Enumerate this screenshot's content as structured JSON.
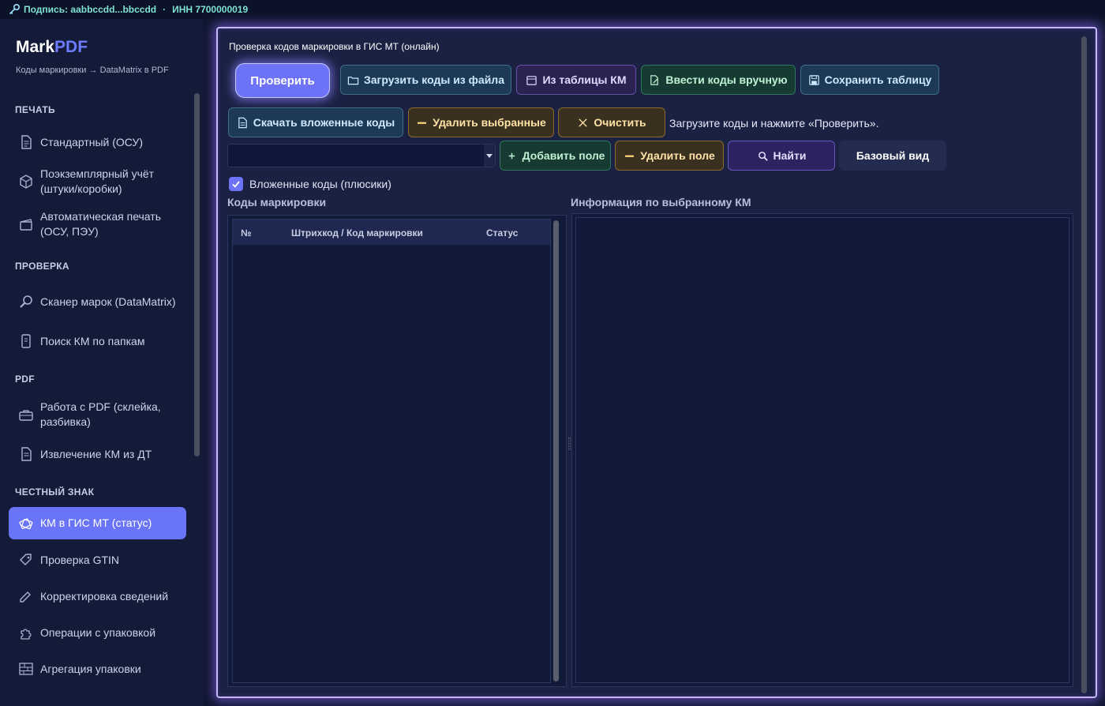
{
  "topbar": {
    "signature": "Подпись: aabbccdd...bbccdd",
    "separator": "·",
    "inn": "ИНН 7700000019",
    "icon": "key-icon"
  },
  "sidebar": {
    "brand_main": "Mark",
    "brand_accent": "PDF",
    "subtitle": "Коды маркировки → DataMatrix в PDF",
    "sections": {
      "print": "ПЕЧАТЬ",
      "check": "ПРОВЕРКА",
      "pdf": "PDF",
      "honest": "ЧЕСТНЫЙ ЗНАК"
    },
    "items": [
      {
        "label": "Стандартный (ОСУ)",
        "icon": "document-icon"
      },
      {
        "label": "Поэкземплярный учёт (штуки/коробки)",
        "icon": "box-icon"
      },
      {
        "label": "Автоматическая печать (ОСУ, ПЭУ)",
        "icon": "clapper-icon"
      },
      {
        "label": "Сканер марок (DataMatrix)",
        "icon": "magnifier-icon"
      },
      {
        "label": "Поиск КМ по папкам",
        "icon": "file-search-icon"
      },
      {
        "label": "Работа с PDF (склейка, разбивка)",
        "icon": "toolbox-icon"
      },
      {
        "label": "Извлечение КМ из ДТ",
        "icon": "document-icon"
      },
      {
        "label": "КМ в ГИС МТ (статус)",
        "icon": "tickets-icon"
      },
      {
        "label": "Проверка GTIN",
        "icon": "tag-icon"
      },
      {
        "label": "Корректировка сведений",
        "icon": "pencil-icon"
      },
      {
        "label": "Операции с упаковкой",
        "icon": "puzzle-icon"
      },
      {
        "label": "Агрегация упаковки",
        "icon": "bricks-icon"
      }
    ],
    "active_index": 7
  },
  "main": {
    "title": "Проверка кодов маркировки в ГИС МТ (онлайн)",
    "buttons": {
      "check": "Проверить",
      "load_file": "Загрузить коды из файла",
      "from_table": "Из таблицы КМ",
      "manual": "Ввести коды вручную",
      "save_table": "Сохранить таблицу",
      "download_nested": "Скачать вложенные коды",
      "delete_selected": "Удалить выбранные",
      "clear": "Очистить",
      "add_field": "Добавить поле",
      "delete_field": "Удалить поле",
      "find": "Найти",
      "base_view": "Базовый вид"
    },
    "hint": "Загрузите коды и нажмите «Проверить».",
    "combo_value": "",
    "nested_checkbox": {
      "label": "Вложенные коды (плюсики)",
      "checked": true
    },
    "codes_title": "Коды маркировки",
    "info_title": "Информация по выбранному КМ",
    "table": {
      "columns": [
        "№",
        "Штрихкод / Код маркировки",
        "Статус"
      ],
      "rows": []
    }
  },
  "colors": {
    "accent": "#6d73f7",
    "glow": "#c8b7ff",
    "background": "#0f1630"
  }
}
